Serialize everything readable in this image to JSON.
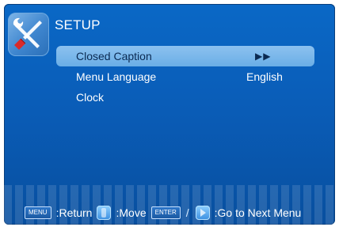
{
  "header": {
    "title": "SETUP",
    "icon": "wrench-screwdriver-icon"
  },
  "menu": {
    "items": [
      {
        "label": "Closed Caption",
        "value": "▶▶",
        "selected": true
      },
      {
        "label": "Menu Language",
        "value": "English",
        "selected": false
      },
      {
        "label": "Clock",
        "value": "",
        "selected": false
      }
    ]
  },
  "footer": {
    "menu_key": "MENU",
    "return_label": ":Return",
    "move_label": ":Move",
    "enter_key": "ENTER",
    "next_label": ":Go to Next Menu"
  },
  "colors": {
    "background": "#0a5db8",
    "highlight": "#7bb8ea"
  }
}
